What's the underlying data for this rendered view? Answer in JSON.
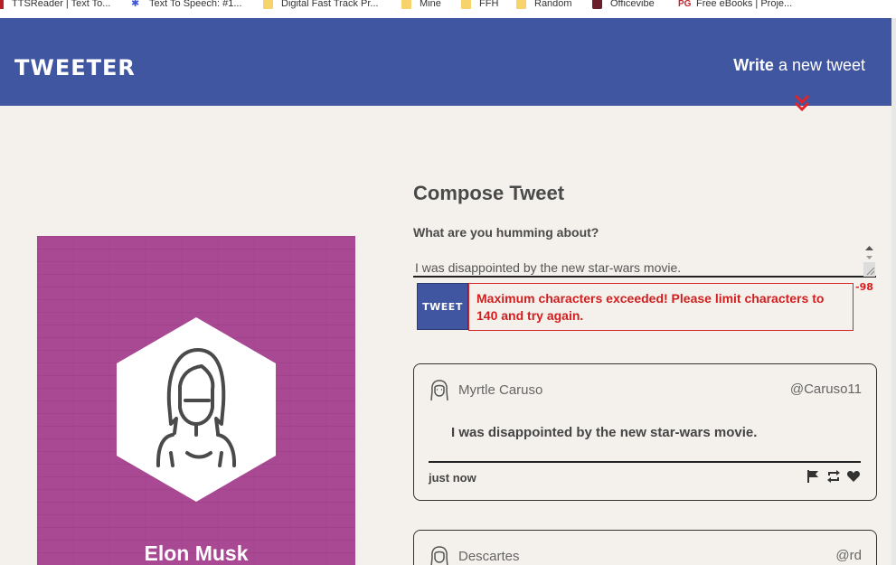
{
  "bookmarks": [
    {
      "label": "TTSReader | Text To...",
      "icon": "ttsreader-icon"
    },
    {
      "label": "Text To Speech: #1...",
      "icon": "speech-icon"
    },
    {
      "label": "Digital Fast Track Pr...",
      "icon": "folder-icon"
    },
    {
      "label": "Mine",
      "icon": "folder-icon"
    },
    {
      "label": "FFH",
      "icon": "folder-icon"
    },
    {
      "label": "Random",
      "icon": "folder-icon"
    },
    {
      "label": "Officevibe",
      "icon": "officevibe-icon"
    },
    {
      "label": "Free eBooks | Proje...",
      "icon": "gutenberg-icon"
    }
  ],
  "header": {
    "logo": "TWEETER",
    "write_bold": "Write",
    "write_rest": " a new tweet",
    "bg_color": "#4056a1",
    "chevron_color": "#e0242a"
  },
  "profile": {
    "name": "Elon Musk",
    "bg_color": "#a94893"
  },
  "compose": {
    "title": "Compose Tweet",
    "label": "What are you humming about?",
    "input_value": "I was disappointed by the new star-wars movie.",
    "counter": "-98",
    "button_label": "TWEET",
    "error_message": "Maximum characters exceeded! Please limit characters to 140 and try again."
  },
  "tweets": [
    {
      "name": "Myrtle Caruso",
      "handle": "@Caruso11",
      "content": "I was disappointed by the new star-wars movie.",
      "time": "just now"
    },
    {
      "name": "Descartes",
      "handle": "@rd"
    }
  ]
}
